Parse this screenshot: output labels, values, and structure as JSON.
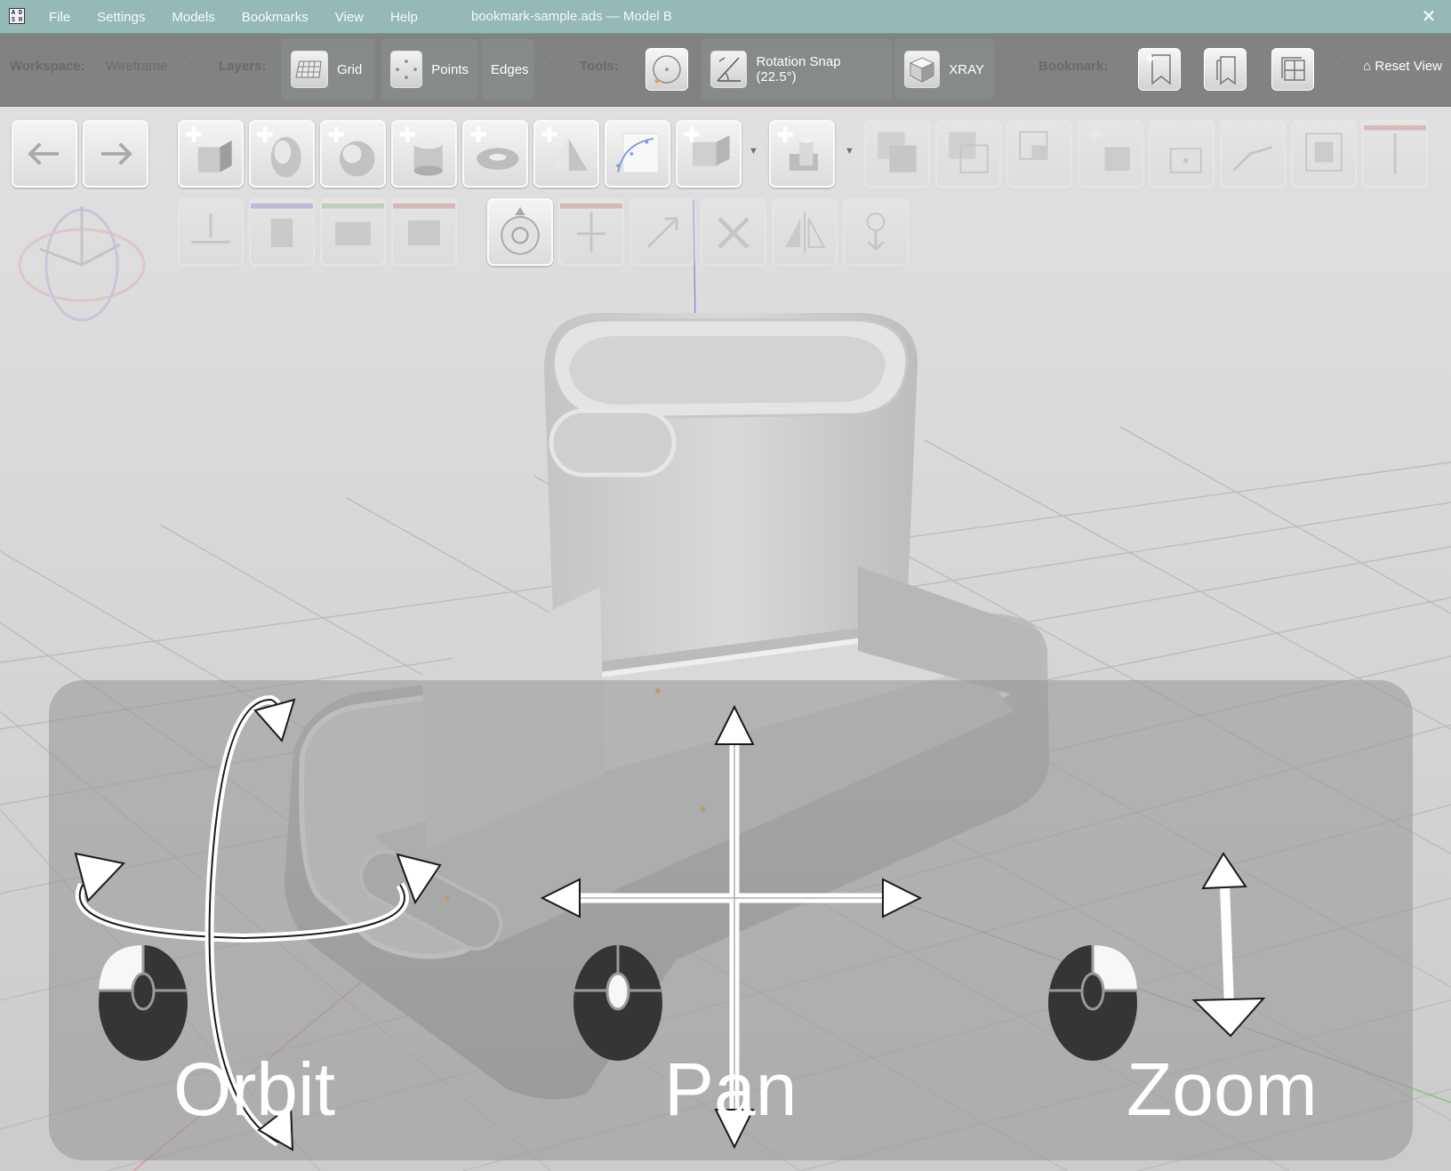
{
  "app": {
    "window_title": "bookmark-sample.ads — Model B",
    "icon": "app-logo-icon",
    "close_glyph": "✕"
  },
  "menu": [
    "File",
    "Settings",
    "Models",
    "Bookmarks",
    "View",
    "Help"
  ],
  "toolbar": {
    "workspace_label": "Workspace:",
    "workspace_value": "Wireframe",
    "layers_label": "Layers:",
    "layers": [
      {
        "label": "Grid",
        "icon": "grid-icon",
        "active": true
      },
      {
        "label": "Points",
        "icon": "points-icon",
        "active": true
      },
      {
        "label": "Edges",
        "icon": "edges-icon",
        "active": true
      }
    ],
    "tools_label": "Tools:",
    "tools": [
      {
        "label": "",
        "icon": "target-icon"
      },
      {
        "label": "Rotation Snap (22.5°)",
        "icon": "rotation-snap-icon"
      },
      {
        "label": "XRAY",
        "icon": "xray-cube-icon"
      }
    ],
    "bookmark_label": "Bookmark:",
    "bookmark_buttons": [
      "add-bookmark-icon",
      "bookmarks-list-icon",
      "bookmark-grid-icon"
    ],
    "reset_view": "⌂ Reset View"
  },
  "tool_palette": {
    "history": [
      "undo-arrow-icon",
      "redo-arrow-icon"
    ],
    "primitives": [
      "add-box-icon",
      "add-ellipsoid-icon",
      "add-sphere-icon",
      "add-cylinder-icon",
      "add-torus-icon",
      "add-cone-icon",
      "add-curve-icon",
      "add-extrude-icon",
      "add-boolean-icon"
    ],
    "disabled_row1": [
      "union-icon",
      "subtract-icon",
      "intersect-icon",
      "add-group-icon",
      "add-point-icon",
      "fillet-icon",
      "shell-icon",
      "align-icon"
    ],
    "disabled_row2": [
      "drop-to-floor-icon",
      "align-center-icon",
      "distribute-icon",
      "align-right-icon"
    ],
    "active_row2": [
      "orbit-target-icon"
    ],
    "disabled_row2b": [
      "split-icon",
      "scale-icon",
      "delete-icon",
      "mirror-icon",
      "place-icon"
    ]
  },
  "navigation_help": {
    "orbit": "Orbit",
    "pan": "Pan",
    "zoom": "Zoom"
  },
  "colors": {
    "titlebar": "#94b9b7",
    "toolbar": "#828282",
    "viewport_bg": "#d6d6d6",
    "axis_blue": "#7b7fd6",
    "axis_red": "#d88f8f",
    "axis_green": "#7fbf7f"
  }
}
